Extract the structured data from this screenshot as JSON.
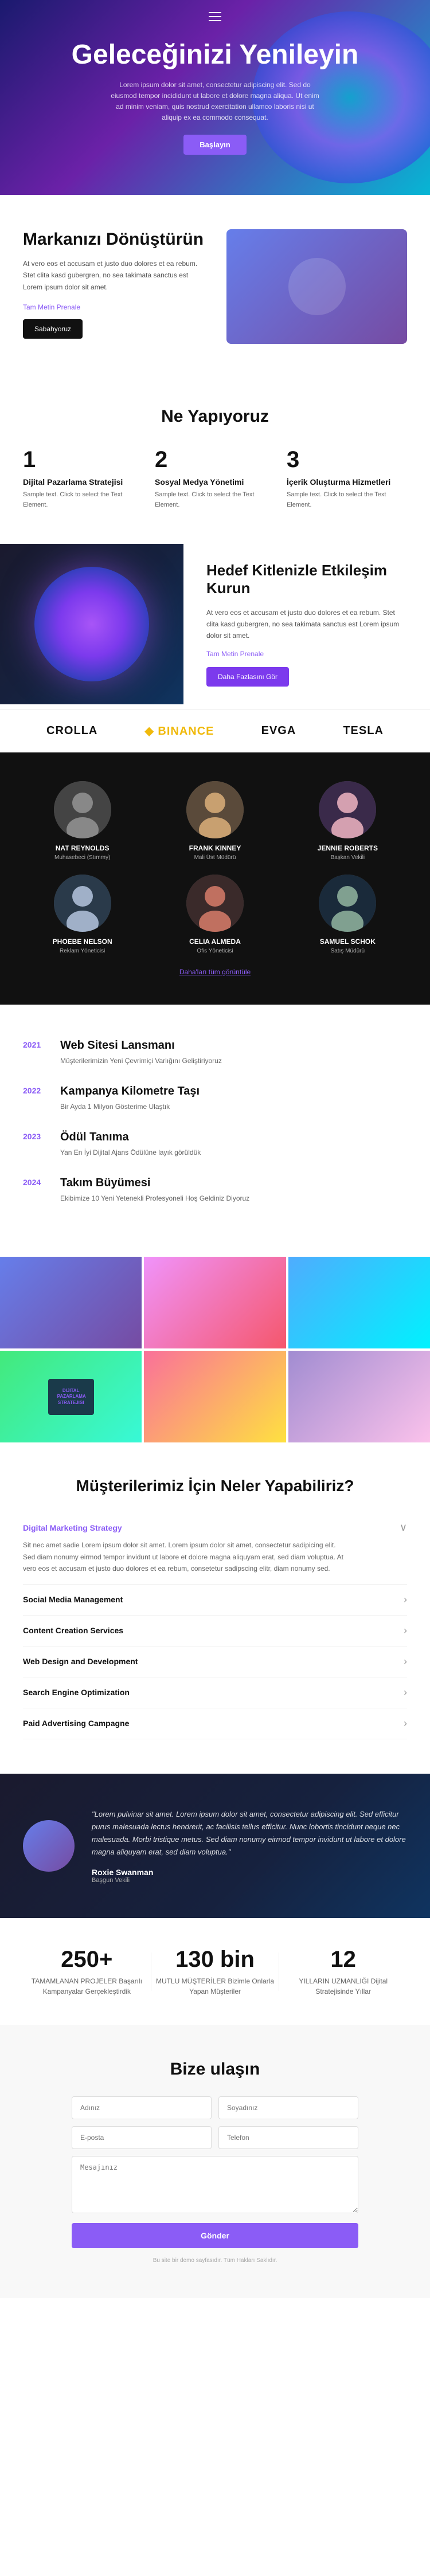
{
  "nav": {
    "hamburger_label": "menu"
  },
  "hero": {
    "title": "Geleceğinizi Yenileyin",
    "subtitle": "Lorem ipsum dolor sit amet, consectetur adipiscing elit. Sed do eiusmod tempor incididunt ut labore et dolore magna aliqua. Ut enim ad minim veniam, quis nostrud exercitation ullamco laboris nisi ut aliquip ex ea commodo consequat.",
    "button_label": "Başlayın"
  },
  "transform": {
    "heading": "Markanızı Dönüştürün",
    "body": "At vero eos et accusam et justo duo dolores et ea rebum. Stet clita kasd gubergren, no sea takimata sanctus est Lorem ipsum dolor sit amet.",
    "link_text": "Tam Metin Prenale",
    "button_label": "Sabahyoruz"
  },
  "what": {
    "heading": "Ne Yapıyoruz",
    "services": [
      {
        "number": "1",
        "title": "Dijital Pazarlama Stratejisi",
        "desc": "Sample text. Click to select the Text Element."
      },
      {
        "number": "2",
        "title": "Sosyal Medya Yönetimi",
        "desc": "Sample text. Click to select the Text Element."
      },
      {
        "number": "3",
        "title": "İçerik Oluşturma Hizmetleri",
        "desc": "Sample text. Click to select the Text Element."
      }
    ]
  },
  "engage": {
    "heading": "Hedef Kitlenizle Etkileşim Kurun",
    "body": "At vero eos et accusam et justo duo dolores et ea rebum. Stet clita kasd gubergren, no sea takimata sanctus est Lorem ipsum dolor sit amet.",
    "link_text": "Tam Metin Prenale",
    "button_label": "Daha Fazlasını Gör"
  },
  "logos": [
    {
      "name": "CROLLA",
      "class": ""
    },
    {
      "name": "◆ BINANCE",
      "class": "binance"
    },
    {
      "name": "EVGA",
      "class": ""
    },
    {
      "name": "TESLA",
      "class": ""
    }
  ],
  "team": {
    "members": [
      {
        "name": "NAT REYNOLDS",
        "role": "Muhasebeci (Stımmy)"
      },
      {
        "name": "FRANK KINNEY",
        "role": "Mali Üst Müdürü"
      },
      {
        "name": "JENNIE ROBERTS",
        "role": "Başkan Vekili"
      },
      {
        "name": "PHOEBE NELSON",
        "role": "Reklam Yöneticisi"
      },
      {
        "name": "CELIA ALMEDA",
        "role": "Ofis Yöneticisi"
      },
      {
        "name": "SAMUEL SCHOK",
        "role": "Satış Müdürü"
      }
    ],
    "show_more": "Daha'ları tüm görüntüle"
  },
  "timeline": {
    "items": [
      {
        "year": "2021",
        "title": "Web Sitesi Lansmanı",
        "desc": "Müşterilerimizin Yeni Çevrimiçi Varlığını Geliştiriyoruz"
      },
      {
        "year": "2022",
        "title": "Kampanya Kilometre Taşı",
        "desc": "Bir Ayda 1 Milyon Gösterime Ulaştık"
      },
      {
        "year": "2023",
        "title": "Ödül Tanıma",
        "desc": "Yan En İyi Dijital Ajans Ödülüne layık görüldük"
      },
      {
        "year": "2024",
        "title": "Takım Büyümesi",
        "desc": "Ekibimize 10 Yeni Yetenekli Profesyoneli Hoş Geldiniz Diyoruz"
      }
    ]
  },
  "accordion": {
    "heading": "Müşterilerimiz İçin Neler Yapabiliriz?",
    "items": [
      {
        "title": "Digital Marketing Strategy",
        "active": true,
        "body": "Sit nec amet sadie Lorem ipsum dolor sit amet. Lorem ipsum dolor sit amet, consectetur sadipicing elit. Sed diam nonumy eirmod tempor invidunt ut labore et dolore magna aliquyam erat, sed diam voluptua. At vero eos et accusam et justo duo dolores et ea rebum, consetetur sadipscing elitr, diam nonumy sed."
      },
      {
        "title": "Social Media Management",
        "active": false,
        "body": ""
      },
      {
        "title": "Content Creation Services",
        "active": false,
        "body": ""
      },
      {
        "title": "Web Design and Development",
        "active": false,
        "body": ""
      },
      {
        "title": "Search Engine Optimization",
        "active": false,
        "body": ""
      },
      {
        "title": "Paid Advertising Campagne",
        "active": false,
        "body": ""
      }
    ]
  },
  "testimonial": {
    "quote": "\"Lorem pulvinar sit amet. Lorem ipsum dolor sit amet, consectetur adipiscing elit. Sed efficitur purus malesuada lectus hendrerit, ac facilisis tellus efficitur. Nunc lobortis tincidunt neque nec malesuada. Morbi tristique metus. Sed diam nonumy eirmod tempor invidunt ut labore et dolore magna aliquyam erat, sed diam voluptua.\"",
    "name": "Roxie Swanman",
    "role": "Başgun Vekili"
  },
  "stats": [
    {
      "number": "250+",
      "label": "TAMAMLANAN PROJELER\nBaşarılı Kampanyalar Gerçekleştirdik"
    },
    {
      "number": "130 bin",
      "label": "MUTLU MÜŞTERİLER\nBizimle Onlarla Yapan Müşteriler"
    },
    {
      "number": "12",
      "label": "YILLARIN UZMANLIĞI\nDijital Stratejisinde Yıllar"
    }
  ],
  "contact": {
    "heading": "Bize ulaşın",
    "fields": {
      "first_name_placeholder": "Adınız",
      "last_name_placeholder": "Soyadınız",
      "email_placeholder": "E-posta",
      "phone_placeholder": "Telefon",
      "message_placeholder": "Mesajınız",
      "submit_label": "Gönder"
    },
    "footer_text": "Bu site bir demo sayfasıdır. Tüm Hakları Saklıdır."
  }
}
